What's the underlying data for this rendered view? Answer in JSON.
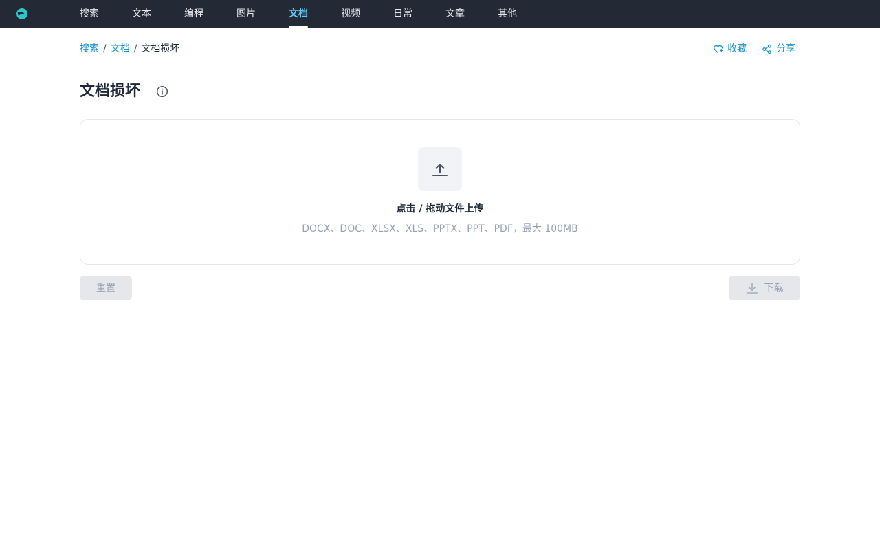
{
  "nav": {
    "items": [
      {
        "label": "搜索"
      },
      {
        "label": "文本"
      },
      {
        "label": "编程"
      },
      {
        "label": "图片"
      },
      {
        "label": "文档"
      },
      {
        "label": "视频"
      },
      {
        "label": "日常"
      },
      {
        "label": "文章"
      },
      {
        "label": "其他"
      }
    ],
    "active": "文档"
  },
  "breadcrumb": {
    "items": [
      "搜索",
      "文档"
    ],
    "current": "文档损坏",
    "separator": "/"
  },
  "actions": {
    "favorite_label": "收藏",
    "share_label": "分享"
  },
  "page": {
    "title": "文档损坏"
  },
  "upload": {
    "main_text": "点击 / 拖动文件上传",
    "hint_text": "DOCX、DOC、XLSX、XLS、PPTX、PPT、PDF，最大 100MB"
  },
  "buttons": {
    "reset_label": "重置",
    "download_label": "下载"
  },
  "colors": {
    "topbar_bg": "#232a36",
    "accent": "#1a94c8",
    "nav_active": "#67c8f5",
    "disabled_bg": "#e5e7eb"
  },
  "icons": [
    "logo-icon",
    "heart-plus-icon",
    "share-icon",
    "info-icon",
    "upload-icon",
    "download-icon"
  ]
}
